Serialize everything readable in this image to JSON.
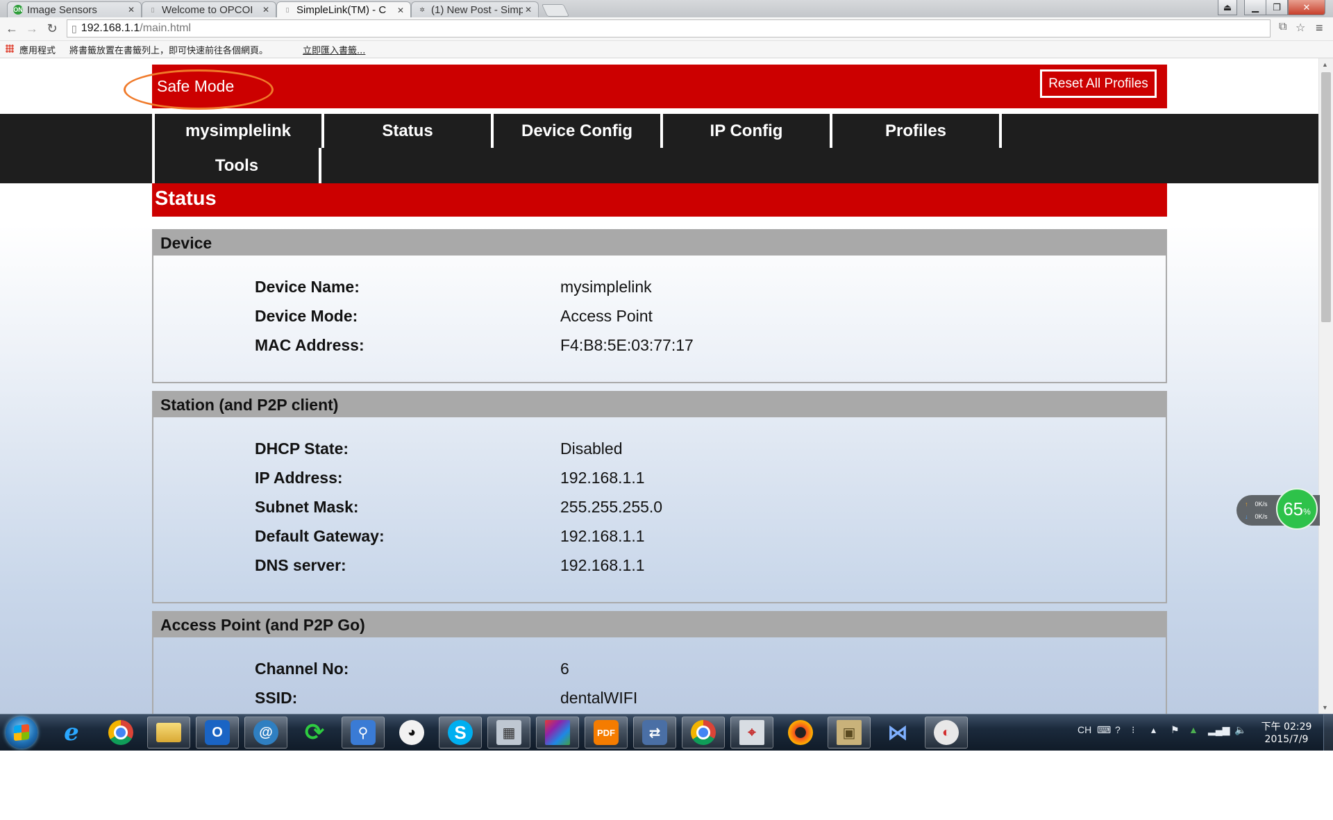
{
  "browser": {
    "tabs": [
      {
        "title": "Image Sensors",
        "favicon": "ON"
      },
      {
        "title": "Welcome to OPCOI",
        "favicon": "page"
      },
      {
        "title": "SimpleLink(TM) - C",
        "favicon": "page",
        "active": true
      },
      {
        "title": "(1) New Post - Simp",
        "favicon": "loading"
      }
    ],
    "address": {
      "host": "192.168.1.1",
      "path": "/main.html"
    },
    "bookmarks": {
      "apps_label": "應用程式",
      "hint": "將書籤放置在書籤列上，即可快速前往各個網頁。",
      "import_link": "立即匯入書籤..."
    }
  },
  "page": {
    "header": {
      "safe_mode": "Safe Mode",
      "reset_button": "Reset All Profiles"
    },
    "nav": [
      {
        "label": "mysimplelink"
      },
      {
        "label": "Status"
      },
      {
        "label": "Device Config"
      },
      {
        "label": "IP Config"
      },
      {
        "label": "Profiles"
      },
      {
        "label": "Tools"
      }
    ],
    "title": "Status",
    "sections": {
      "device": {
        "heading": "Device",
        "rows": [
          {
            "label": "Device Name:",
            "value": "mysimplelink"
          },
          {
            "label": "Device Mode:",
            "value": "Access Point"
          },
          {
            "label": "MAC Address:",
            "value": "F4:B8:5E:03:77:17"
          }
        ]
      },
      "station": {
        "heading": "Station (and P2P client)",
        "rows": [
          {
            "label": "DHCP State:",
            "value": "Disabled"
          },
          {
            "label": "IP Address:",
            "value": "192.168.1.1"
          },
          {
            "label": "Subnet Mask:",
            "value": "255.255.255.0"
          },
          {
            "label": "Default Gateway:",
            "value": "192.168.1.1"
          },
          {
            "label": "DNS server:",
            "value": "192.168.1.1"
          }
        ]
      },
      "ap": {
        "heading": "Access Point (and P2P Go)",
        "rows": [
          {
            "label": "Channel No:",
            "value": "6"
          },
          {
            "label": "SSID:",
            "value": "dentalWIFI"
          }
        ]
      }
    }
  },
  "net_monitor": {
    "up_rate": "0K/s",
    "down_rate": "0K/s",
    "percent": "65",
    "percent_unit": "%"
  },
  "taskbar": {
    "apps": [
      "internet-explorer",
      "chrome",
      "file-explorer",
      "outlook",
      "network-tool",
      "sync",
      "magnifier",
      "panda",
      "skype",
      "calculator",
      "color-app",
      "pdf",
      "network-setup",
      "chrome",
      "screen-capture",
      "media-player",
      "package",
      "visual-studio",
      "paint"
    ],
    "tray": {
      "lang": "CH"
    },
    "clock": {
      "time": "下午 02:29",
      "date": "2015/7/9"
    }
  },
  "colors": {
    "brand_red": "#cc0000",
    "nav_dark": "#1e1e1e",
    "section_head": "#a9a9a9",
    "highlight_orange": "#f07a2a"
  }
}
